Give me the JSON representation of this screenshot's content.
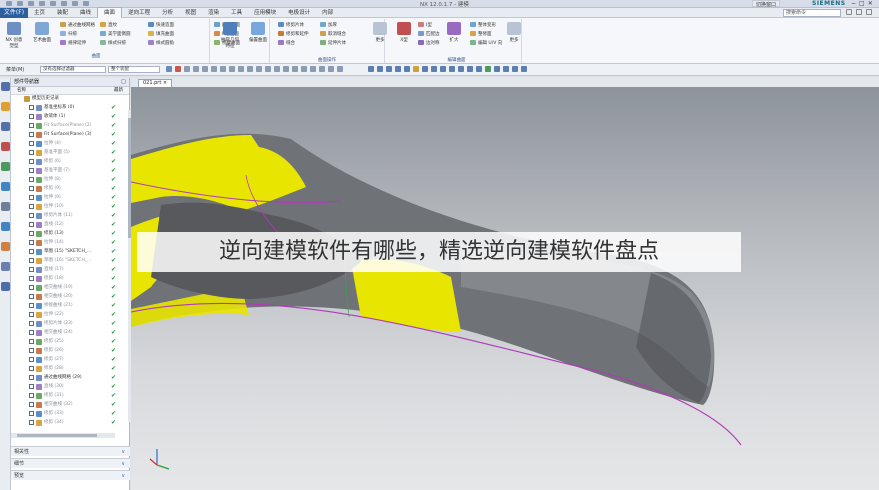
{
  "window": {
    "title": "NX 12.0.1.7 - 建模",
    "brand": "SIEMENS",
    "switch_label": "切换窗口",
    "controls": [
      "−",
      "□",
      "✕"
    ]
  },
  "menu": {
    "file": "文件(F)",
    "tabs": [
      "主页",
      "装配",
      "曲线",
      "曲面",
      "逆向工程",
      "分析",
      "视图",
      "渲染",
      "工具",
      "应用模块",
      "电极设计",
      "内部"
    ],
    "active_tab": "曲面",
    "search_placeholder": "搜索命令"
  },
  "ribbon": {
    "groups": [
      {
        "name": "",
        "big": [
          "NX 创意塑型",
          "艺术曲面"
        ],
        "small": [
          "通过曲线网格",
          "扫掠",
          "规律延伸",
          "直纹",
          "美学面倒圆",
          "样式扫掠",
          "快速造面",
          "填充曲面",
          "样式圆角"
        ]
      },
      {
        "name": "曲面",
        "big": [
          "曲面"
        ],
        "small": [
          "四点曲面",
          "N边曲面",
          "桥接曲面"
        ]
      },
      {
        "name": "",
        "big": [
          "抽取几何特征",
          "偏置曲面"
        ],
        "small": [
          "修剪片体",
          "修剪和延伸",
          "缝合",
          "加厚",
          "取消缝合",
          "延伸片体"
        ]
      },
      {
        "name": "曲面操作",
        "big": [
          "更多"
        ],
        "small": []
      },
      {
        "name": "",
        "big": [
          "X型",
          "扩大"
        ],
        "small": [
          "I型",
          "匹配边",
          "边对称",
          "整体变形",
          "整修面",
          "编辑 U/V 向"
        ]
      },
      {
        "name": "编辑曲面",
        "big": [
          "更多"
        ],
        "small": []
      }
    ]
  },
  "toolbar2": {
    "menu_label": "菜单(M)",
    "filter_value": "没有选择过滤器",
    "assembly_value": "整个装配"
  },
  "file_tab": "021.prt ×",
  "navigator": {
    "title": "部件导航器",
    "col_name": "名称",
    "col_latest": "最新",
    "items": [
      {
        "label": "模型历史记录",
        "level": 0,
        "gray": false,
        "check": false
      },
      {
        "label": "基准坐标系 (0)",
        "level": 1,
        "gray": false,
        "check": true
      },
      {
        "label": "收敛体 (1)",
        "level": 1,
        "gray": false,
        "check": true
      },
      {
        "label": "Fit Surface(Plane) (2)",
        "level": 1,
        "gray": true,
        "check": true
      },
      {
        "label": "Fit Surface(Plane) (3)",
        "level": 1,
        "gray": false,
        "check": true
      },
      {
        "label": "拉伸 (4)",
        "level": 1,
        "gray": true,
        "check": true
      },
      {
        "label": "基准平面 (5)",
        "level": 1,
        "gray": true,
        "check": true
      },
      {
        "label": "修剪 (6)",
        "level": 1,
        "gray": true,
        "check": true
      },
      {
        "label": "基准平面 (7)",
        "level": 1,
        "gray": true,
        "check": true
      },
      {
        "label": "拉伸 (8)",
        "level": 1,
        "gray": true,
        "check": true
      },
      {
        "label": "修剪 (9)",
        "level": 1,
        "gray": true,
        "check": true
      },
      {
        "label": "拉伸 (9)",
        "level": 1,
        "gray": true,
        "check": true
      },
      {
        "label": "拉伸 (10)",
        "level": 1,
        "gray": true,
        "check": true
      },
      {
        "label": "修剪片体 (11)",
        "level": 1,
        "gray": true,
        "check": true
      },
      {
        "label": "直线 (12)",
        "level": 1,
        "gray": true,
        "check": true
      },
      {
        "label": "修剪 (13)",
        "level": 1,
        "gray": false,
        "check": true
      },
      {
        "label": "拉伸 (14)",
        "level": 1,
        "gray": true,
        "check": true
      },
      {
        "label": "草图 (15) \"SKETCH_...",
        "level": 1,
        "gray": false,
        "check": true
      },
      {
        "label": "草图 (16) \"SKETCH_...",
        "level": 1,
        "gray": true,
        "check": true
      },
      {
        "label": "直线 (17)",
        "level": 1,
        "gray": true,
        "check": true
      },
      {
        "label": "修剪 (18)",
        "level": 1,
        "gray": true,
        "check": true
      },
      {
        "label": "相交曲线 (19)",
        "level": 1,
        "gray": true,
        "check": true
      },
      {
        "label": "相交曲线 (20)",
        "level": 1,
        "gray": true,
        "check": true
      },
      {
        "label": "桥接曲线 (21)",
        "level": 1,
        "gray": true,
        "check": true
      },
      {
        "label": "拉伸 (22)",
        "level": 1,
        "gray": true,
        "check": true
      },
      {
        "label": "修剪片体 (23)",
        "level": 1,
        "gray": true,
        "check": true
      },
      {
        "label": "相交曲线 (24)",
        "level": 1,
        "gray": true,
        "check": true
      },
      {
        "label": "修剪 (25)",
        "level": 1,
        "gray": true,
        "check": true
      },
      {
        "label": "修剪 (26)",
        "level": 1,
        "gray": true,
        "check": true
      },
      {
        "label": "修剪 (27)",
        "level": 1,
        "gray": true,
        "check": true
      },
      {
        "label": "修剪 (28)",
        "level": 1,
        "gray": true,
        "check": true
      },
      {
        "label": "通过曲线网格 (29)",
        "level": 1,
        "gray": false,
        "check": true
      },
      {
        "label": "直线 (30)",
        "level": 1,
        "gray": true,
        "check": true
      },
      {
        "label": "修剪 (31)",
        "level": 1,
        "gray": true,
        "check": true
      },
      {
        "label": "相交曲线 (32)",
        "level": 1,
        "gray": true,
        "check": true
      },
      {
        "label": "修剪 (33)",
        "level": 1,
        "gray": true,
        "check": true
      },
      {
        "label": "修剪 (34)",
        "level": 1,
        "gray": true,
        "check": true
      }
    ]
  },
  "panels": [
    {
      "label": "相关性"
    },
    {
      "label": "细节"
    },
    {
      "label": "预览"
    }
  ],
  "banner_text": "逆向建模软件有哪些，精选逆向建模软件盘点",
  "colors": {
    "accent": "#2b5f9e",
    "surface_yellow": "#e8e600",
    "curve_magenta": "#b03ab8",
    "check_green": "#1a9a3a"
  }
}
